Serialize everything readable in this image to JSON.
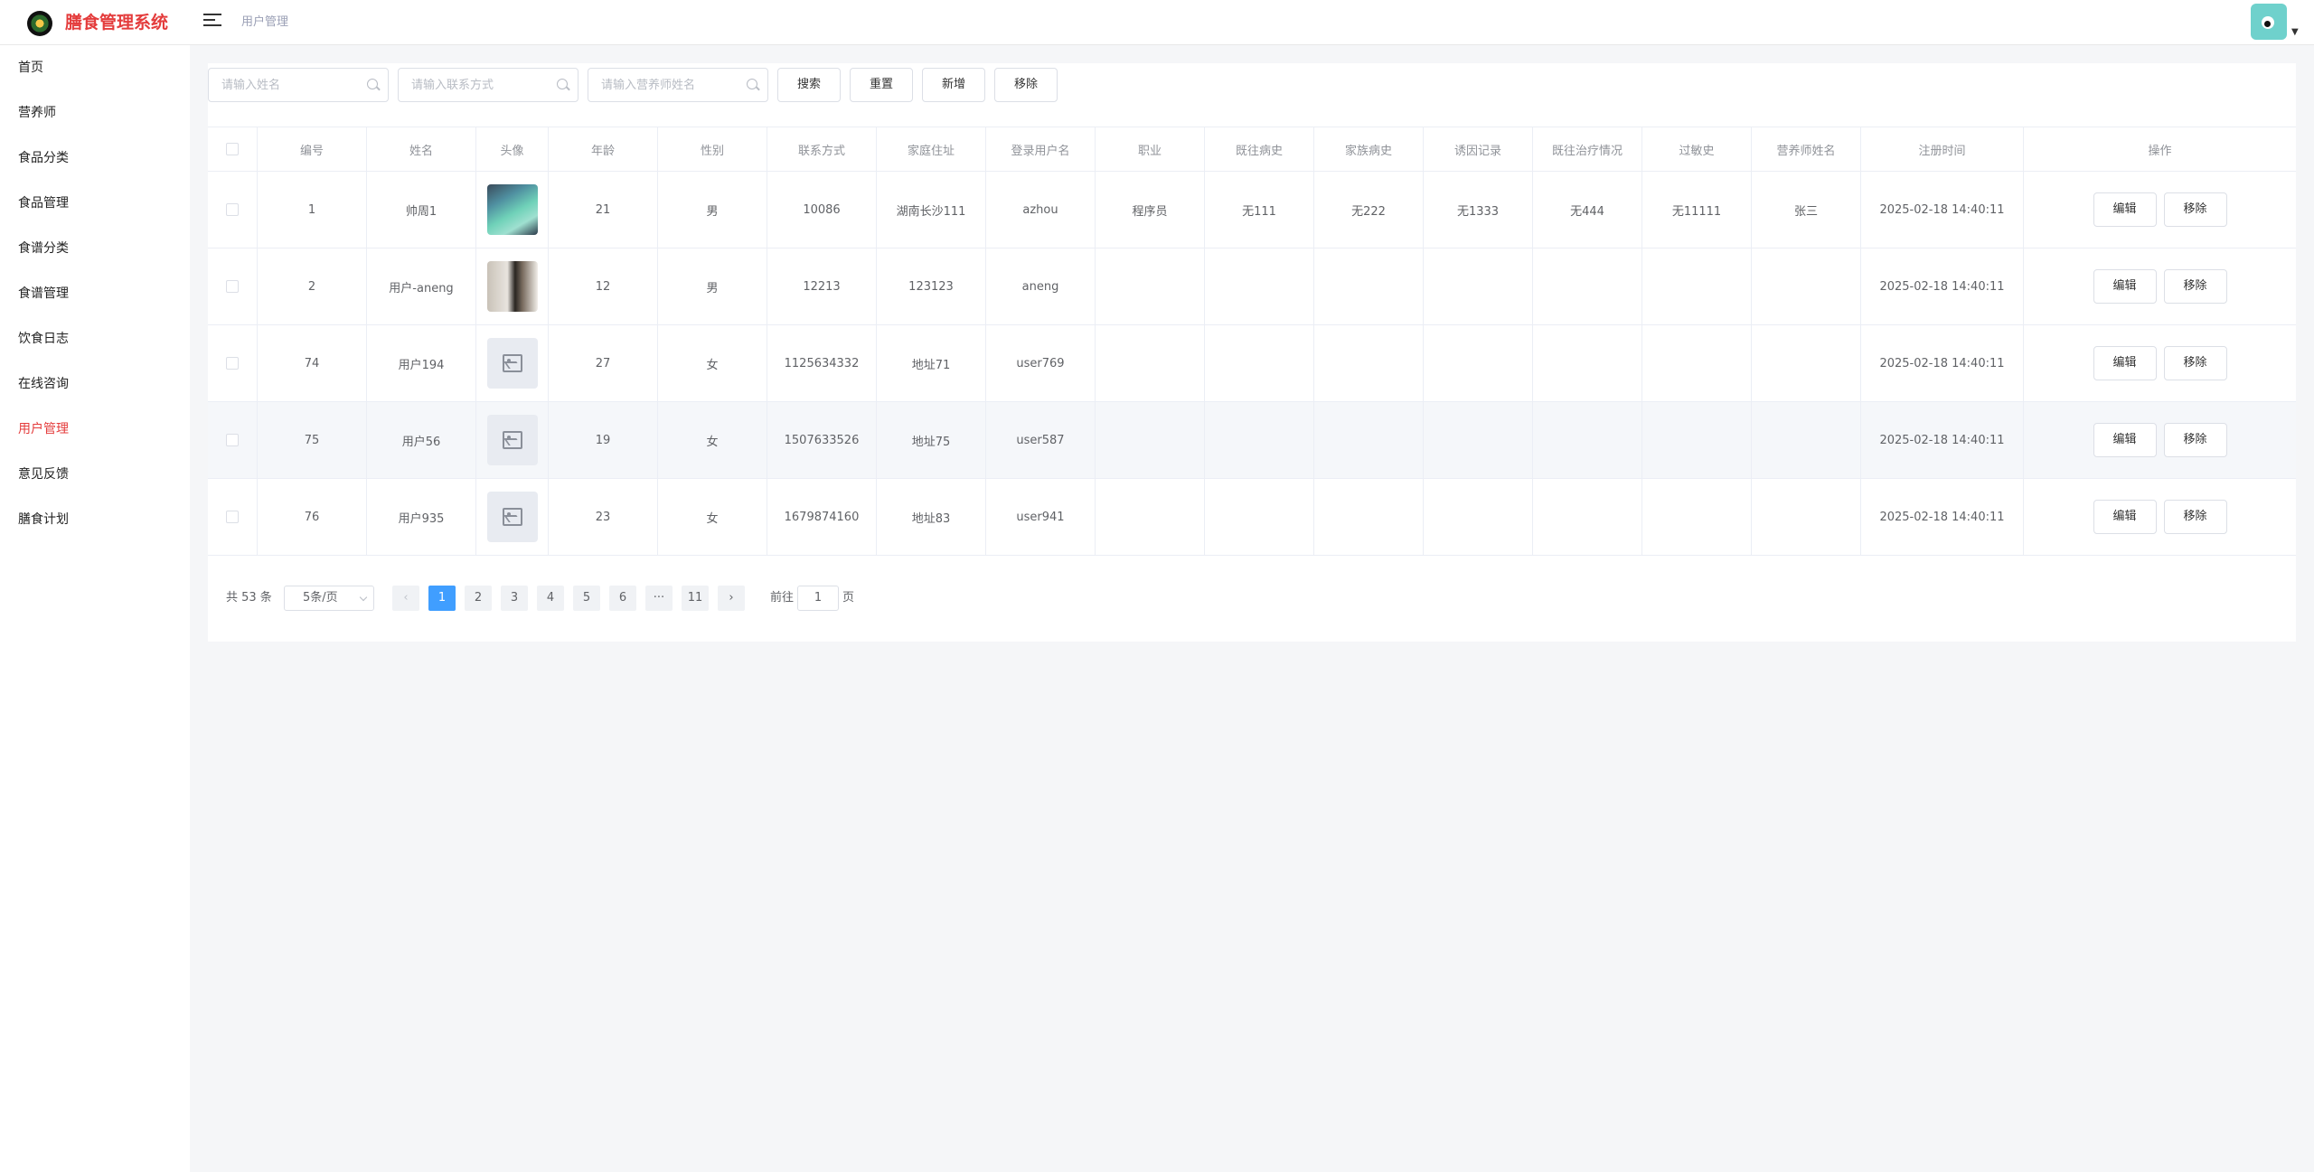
{
  "header": {
    "app_title": "膳食管理系统",
    "breadcrumb": "用户管理"
  },
  "sidebar": {
    "items": [
      {
        "label": "首页"
      },
      {
        "label": "营养师"
      },
      {
        "label": "食品分类"
      },
      {
        "label": "食品管理"
      },
      {
        "label": "食谱分类"
      },
      {
        "label": "食谱管理"
      },
      {
        "label": "饮食日志"
      },
      {
        "label": "在线咨询"
      },
      {
        "label": "用户管理",
        "active": true
      },
      {
        "label": "意见反馈"
      },
      {
        "label": "膳食计划"
      }
    ]
  },
  "filters": {
    "name_placeholder": "请输入姓名",
    "contact_placeholder": "请输入联系方式",
    "dietitian_placeholder": "请输入营养师姓名",
    "search_label": "搜索",
    "reset_label": "重置",
    "add_label": "新增",
    "remove_label": "移除"
  },
  "table": {
    "columns": [
      "编号",
      "姓名",
      "头像",
      "年龄",
      "性别",
      "联系方式",
      "家庭住址",
      "登录用户名",
      "职业",
      "既往病史",
      "家族病史",
      "诱因记录",
      "既往治疗情况",
      "过敏史",
      "营养师姓名",
      "注册时间",
      "操作"
    ],
    "rows": [
      {
        "id": "1",
        "name": "帅周1",
        "avatar": "photo-notebook",
        "age": "21",
        "gender": "男",
        "contact": "10086",
        "address": "湖南长沙111",
        "username": "azhou",
        "job": "程序员",
        "history": "无111",
        "family": "无222",
        "trigger": "无1333",
        "treatment": "无444",
        "allergy": "无11111",
        "dietitian": "张三",
        "time": "2025-02-18 14:40:11"
      },
      {
        "id": "2",
        "name": "用户-aneng",
        "avatar": "photo-person",
        "age": "12",
        "gender": "男",
        "contact": "12213",
        "address": "123123",
        "username": "aneng",
        "job": "",
        "history": "",
        "family": "",
        "trigger": "",
        "treatment": "",
        "allergy": "",
        "dietitian": "",
        "time": "2025-02-18 14:40:11"
      },
      {
        "id": "74",
        "name": "用户194",
        "avatar": "placeholder",
        "age": "27",
        "gender": "女",
        "contact": "1125634332",
        "address": "地址71",
        "username": "user769",
        "job": "",
        "history": "",
        "family": "",
        "trigger": "",
        "treatment": "",
        "allergy": "",
        "dietitian": "",
        "time": "2025-02-18 14:40:11"
      },
      {
        "id": "75",
        "name": "用户56",
        "avatar": "placeholder",
        "age": "19",
        "gender": "女",
        "contact": "1507633526",
        "address": "地址75",
        "username": "user587",
        "job": "",
        "history": "",
        "family": "",
        "trigger": "",
        "treatment": "",
        "allergy": "",
        "dietitian": "",
        "time": "2025-02-18 14:40:11"
      },
      {
        "id": "76",
        "name": "用户935",
        "avatar": "placeholder",
        "age": "23",
        "gender": "女",
        "contact": "1679874160",
        "address": "地址83",
        "username": "user941",
        "job": "",
        "history": "",
        "family": "",
        "trigger": "",
        "treatment": "",
        "allergy": "",
        "dietitian": "",
        "time": "2025-02-18 14:40:11"
      }
    ],
    "edit_label": "编辑",
    "remove_label": "移除"
  },
  "pagination": {
    "total": "共 53 条",
    "page_size": "5条/页",
    "pages": [
      "1",
      "2",
      "3",
      "4",
      "5",
      "6",
      "···",
      "11"
    ],
    "current": "1",
    "goto_label": "前往",
    "goto_value": "1",
    "page_suffix": "页"
  },
  "colors": {
    "accent": "#e43c3c",
    "primary": "#409eff",
    "hover_row": "#f5f7fa"
  }
}
